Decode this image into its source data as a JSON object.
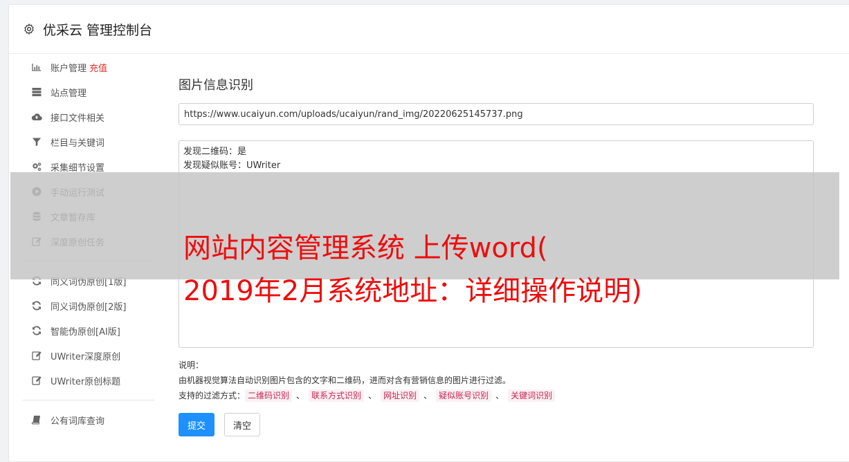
{
  "header": {
    "title": "优采云 管理控制台"
  },
  "sidebar": {
    "group1": [
      {
        "label": "账户管理",
        "extra": "充值",
        "icon": "bar-chart-icon"
      },
      {
        "label": "站点管理",
        "icon": "server-icon"
      },
      {
        "label": "接口文件相关",
        "icon": "cloud-upload-icon"
      },
      {
        "label": "栏目与关键词",
        "icon": "filter-icon"
      },
      {
        "label": "采集细节设置",
        "icon": "gears-icon"
      },
      {
        "label": "手动运行测试",
        "icon": "play-circle-icon"
      },
      {
        "label": "文章暂存库",
        "icon": "database-icon"
      },
      {
        "label": "深度原创任务",
        "icon": "edit-icon"
      }
    ],
    "group2": [
      {
        "label": "同义词伪原创[1版]",
        "icon": "refresh-icon"
      },
      {
        "label": "同义词伪原创[2版]",
        "icon": "refresh-icon"
      },
      {
        "label": "智能伪原创[AI版]",
        "icon": "refresh-icon"
      },
      {
        "label": "UWriter深度原创",
        "icon": "edit-icon"
      },
      {
        "label": "UWriter原创标题",
        "icon": "edit-icon"
      }
    ],
    "group3": [
      {
        "label": "公有词库查询",
        "icon": "book-icon"
      }
    ]
  },
  "main": {
    "section_title": "图片信息识别",
    "url_value": "https://www.ucaiyun.com/uploads/ucaiyun/rand_img/20220625145737.png",
    "result_lines": [
      "发现二维码：是",
      "发现疑似账号：UWriter"
    ],
    "desc_label": "说明：",
    "desc_text": "由机器视觉算法自动识别图片包含的文字和二维码，进而对含有营销信息的图片进行过滤。",
    "filter_label": "支持的过滤方式：",
    "filter_tags": [
      "二维码识别",
      "联系方式识别",
      "网址识别",
      "疑似账号识别",
      "关键词识别"
    ],
    "filter_sep": "、",
    "submit_label": "提交",
    "clear_label": "清空"
  },
  "overlay": {
    "line1": "网站内容管理系统 上传word(",
    "line2": "2019年2月系统地址：详细操作说明)"
  },
  "colors": {
    "accent": "#1e90ff",
    "red": "#e0302c",
    "tag_text": "#c7254e",
    "overlay_text": "#ee0d0d"
  }
}
